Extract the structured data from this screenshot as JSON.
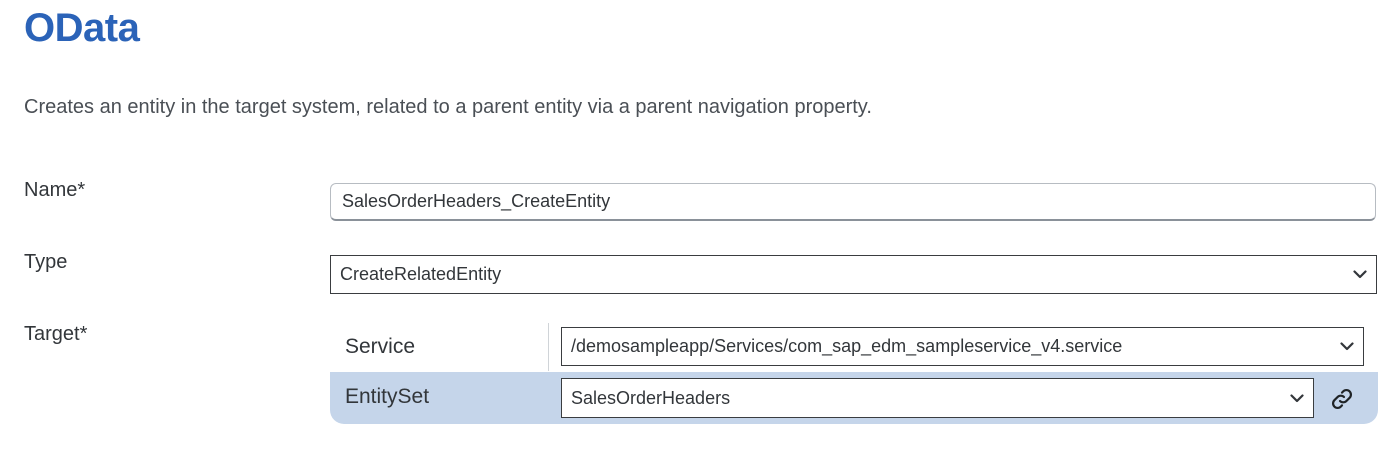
{
  "header": {
    "title": "OData",
    "description": "Creates an entity in the target system, related to a parent entity via a parent navigation property."
  },
  "form": {
    "name": {
      "label": "Name*",
      "value": "SalesOrderHeaders_CreateEntity"
    },
    "type": {
      "label": "Type",
      "selected": "CreateRelatedEntity"
    },
    "target": {
      "label": "Target*",
      "service": {
        "label": "Service",
        "selected": "/demosampleapp/Services/com_sap_edm_sampleservice_v4.service"
      },
      "entityset": {
        "label": "EntitySet",
        "selected": "SalesOrderHeaders"
      }
    }
  },
  "icons": {
    "dropdown": "chevron-down-icon",
    "link": "link-icon"
  },
  "colors": {
    "title": "#2b63b8",
    "selected_row": "#c5d5ea",
    "text": "#32363a"
  }
}
